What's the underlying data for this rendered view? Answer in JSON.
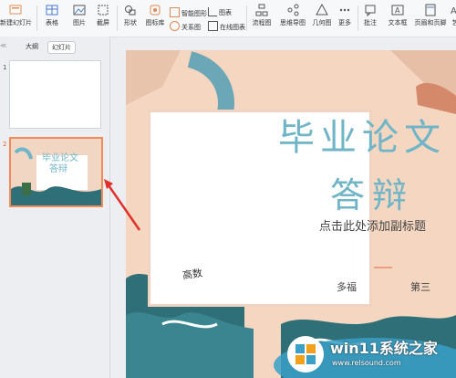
{
  "toolbar": {
    "new_slide": "新建幻灯片",
    "table": "表格",
    "picture": "图片",
    "screenshot": "截屏",
    "shape": "形状",
    "icon_lib": "图标库",
    "smart_graphic": "智能图形",
    "relation_graph": "关系图",
    "chart": "图表",
    "online_chart": "在线图表",
    "flowchart": "流程图",
    "mindmap": "思维导图",
    "geometry": "几何图",
    "more": "更多",
    "comment": "批注",
    "textbox": "文本框",
    "header_footer": "页眉和页脚",
    "last": "艺"
  },
  "left_panel": {
    "tab_outline": "大纲",
    "tab_slides": "幻灯片",
    "slide_numbers": [
      "1",
      "2"
    ]
  },
  "thumbnail": {
    "title1": "毕业论文",
    "title2": "答辩"
  },
  "slide": {
    "title_line1": "毕业论文",
    "title_line2": "答辩",
    "subtitle": "点击此处添加副标题",
    "author": "多福",
    "author2": "第三",
    "book_label": "高数"
  },
  "watermark": {
    "text": "win11系统之家",
    "url": "www.relsound.com"
  },
  "colors": {
    "title": "#6fb5c7",
    "arrow": "#e0302a",
    "selection": "#f08b5a"
  }
}
